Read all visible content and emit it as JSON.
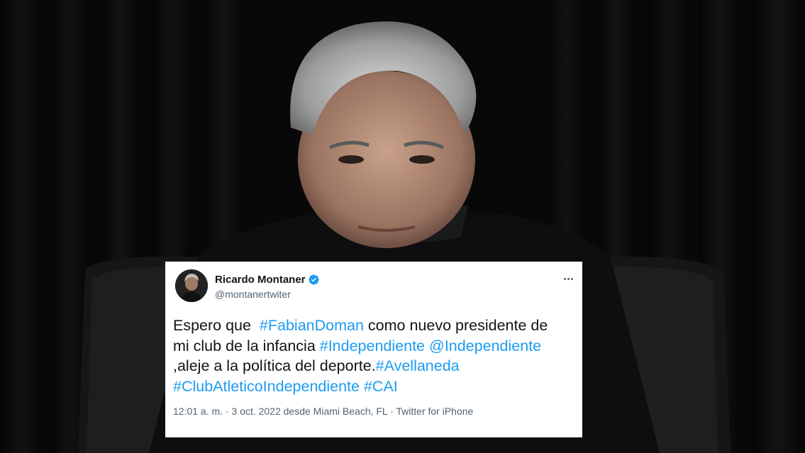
{
  "tweet": {
    "display_name": "Ricardo Montaner",
    "handle": "@montanertwiter",
    "text_lines": [
      [
        {
          "t": "Espero que  ",
          "link": false
        },
        {
          "t": "#FabianDoman",
          "link": true
        },
        {
          "t": " como nuevo presidente de",
          "link": false
        }
      ],
      [
        {
          "t": "mi club de la infancia ",
          "link": false
        },
        {
          "t": "#Independiente",
          "link": true
        },
        {
          "t": " ",
          "link": false
        },
        {
          "t": "@Independiente",
          "link": true
        }
      ],
      [
        {
          "t": ",aleje a la política del deporte.",
          "link": false
        },
        {
          "t": "#Avellaneda",
          "link": true
        }
      ],
      [
        {
          "t": "#ClubAtleticoIndependiente",
          "link": true
        },
        {
          "t": " ",
          "link": false
        },
        {
          "t": "#CAI",
          "link": true
        }
      ]
    ],
    "meta": "12:01 a. m. · 3 oct. 2022 desde Miami Beach, FL · Twitter for iPhone",
    "link_color": "#1d9bf0",
    "verified_color": "#1d9bf0",
    "icons": [
      "verified-badge-icon",
      "more-options-icon"
    ]
  }
}
